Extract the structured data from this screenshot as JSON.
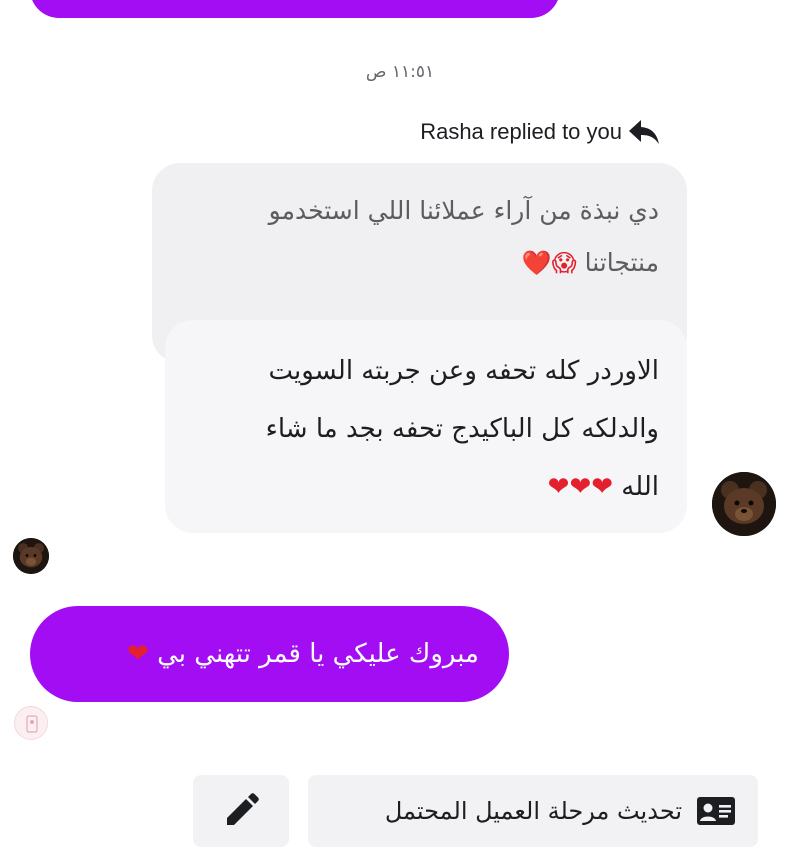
{
  "conversation": {
    "timestamp": "١١:٥١ ص",
    "reply_indicator": {
      "text": "Rasha replied to you",
      "icon": "reply-arrow-icon"
    },
    "quoted_message": {
      "line1": "دي نبذة من آراء عملائنا اللي استخدمو",
      "line2": "منتجاتنا",
      "emojis": "😱❤️"
    },
    "reply_message": {
      "line1": "الاوردر كله تحفه وعن جربته السويت",
      "line2": "والدلكه كل الباكيدج تحفه بجد ما شاء",
      "line3": "الله",
      "hearts": "❤❤❤"
    },
    "my_message": {
      "text": "مبروك عليكي يا قمر تتهني بي",
      "heart": "❤"
    }
  },
  "actions": {
    "edit": {
      "icon": "pencil-icon"
    },
    "update_stage": {
      "label": "تحديث مرحلة العميل المحتمل",
      "icon": "contact-card-icon"
    }
  },
  "colors": {
    "accent": "#a20df3",
    "bubble_gray": "#f0f0f3",
    "heart": "#e4202f"
  }
}
